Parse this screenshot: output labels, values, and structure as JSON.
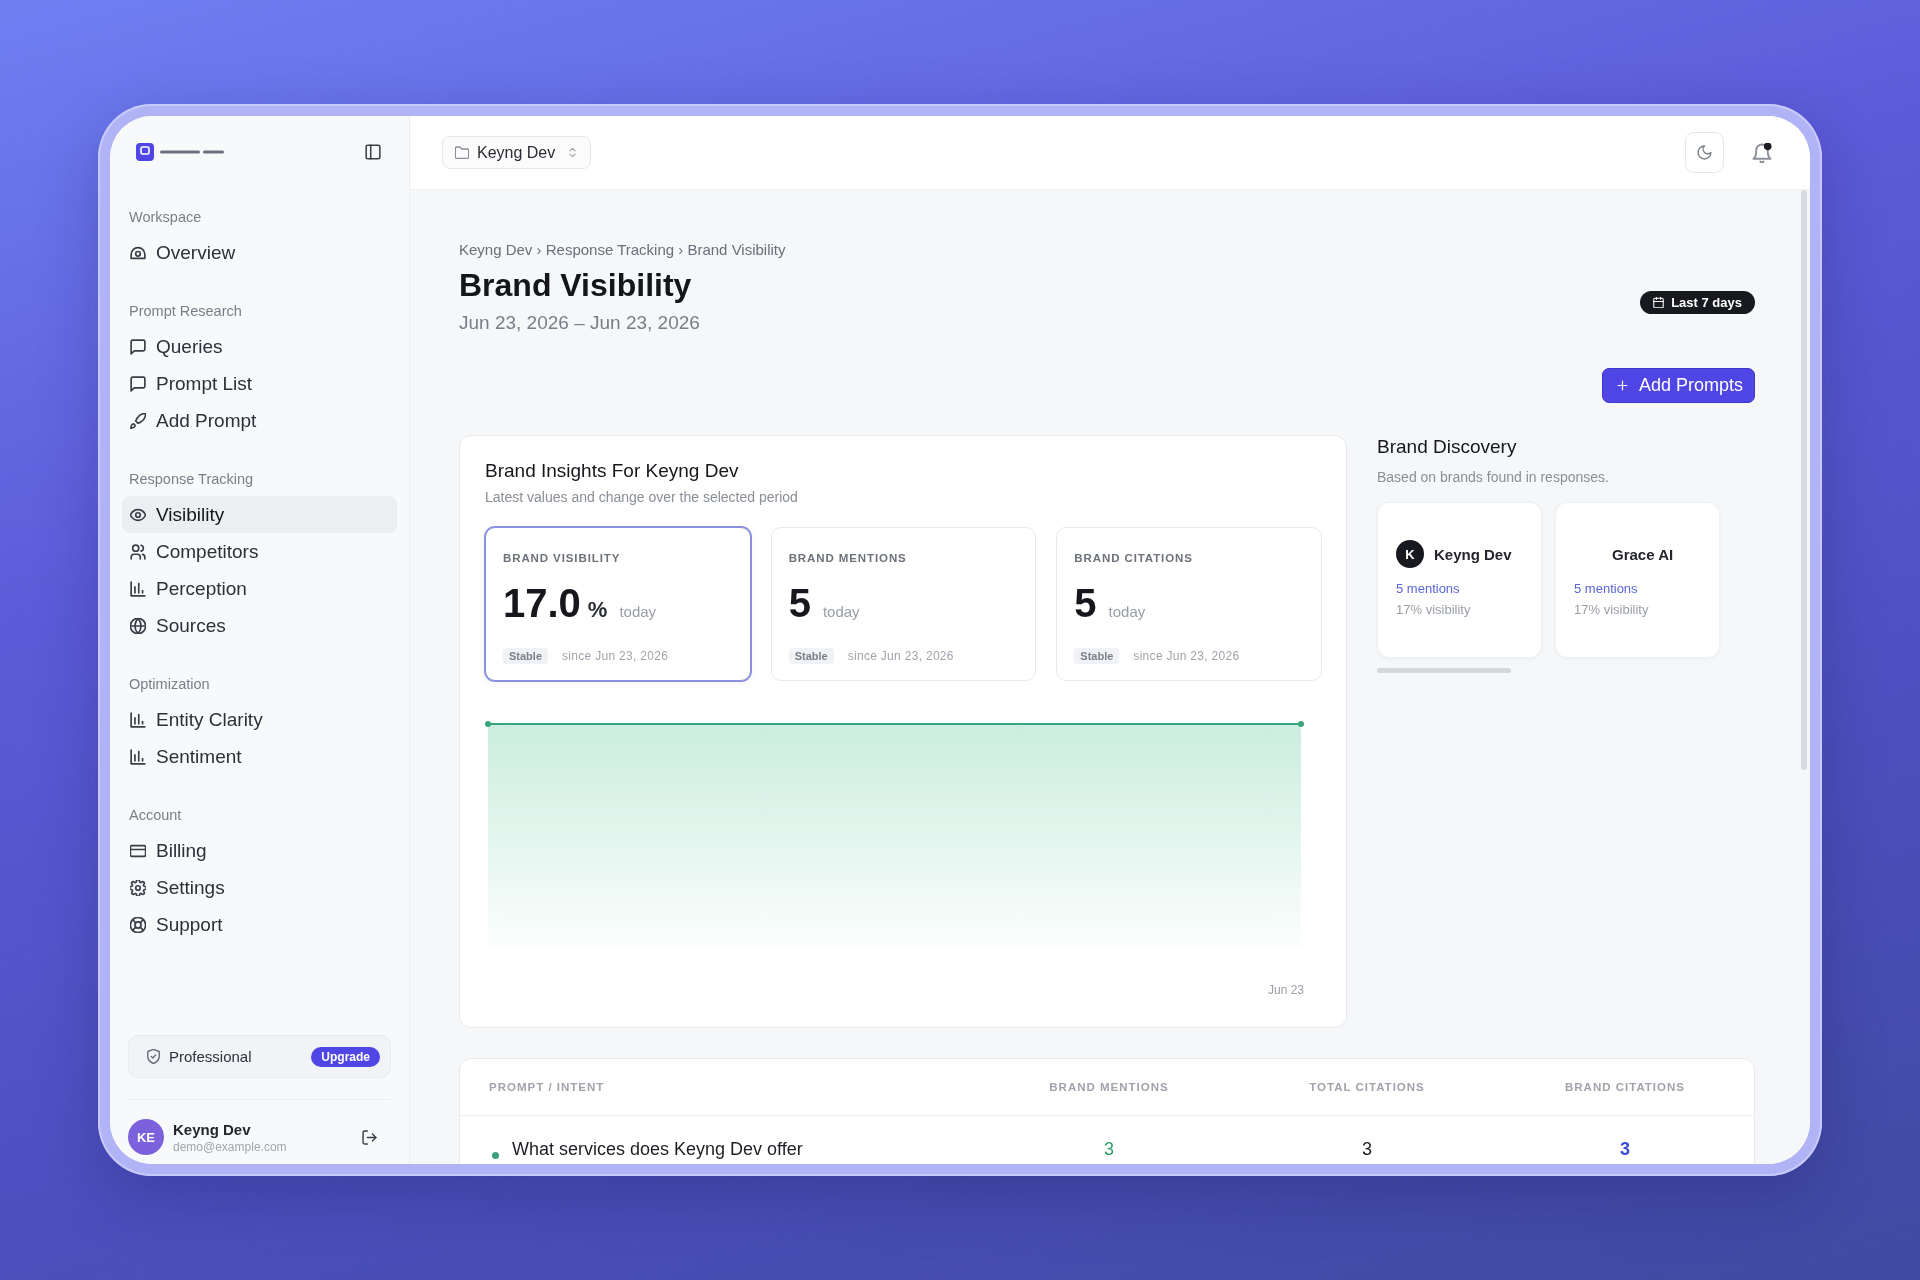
{
  "sidebar": {
    "sections": [
      {
        "title": "Workspace",
        "items": [
          {
            "label": "Overview",
            "selected": false
          }
        ]
      },
      {
        "title": "Prompt Research",
        "items": [
          {
            "label": "Queries",
            "selected": false
          },
          {
            "label": "Prompt List",
            "selected": false
          },
          {
            "label": "Add Prompt",
            "selected": false
          }
        ]
      },
      {
        "title": "Response Tracking",
        "items": [
          {
            "label": "Visibility",
            "selected": true
          },
          {
            "label": "Competitors",
            "selected": false
          },
          {
            "label": "Perception",
            "selected": false
          },
          {
            "label": "Sources",
            "selected": false
          }
        ]
      },
      {
        "title": "Optimization",
        "items": [
          {
            "label": "Entity Clarity",
            "selected": false
          },
          {
            "label": "Sentiment",
            "selected": false
          }
        ]
      },
      {
        "title": "Account",
        "items": [
          {
            "label": "Billing",
            "selected": false
          },
          {
            "label": "Settings",
            "selected": false
          },
          {
            "label": "Support",
            "selected": false
          }
        ]
      }
    ],
    "plan": {
      "name": "Professional",
      "action": "Upgrade"
    },
    "user": {
      "initials": "KE",
      "name": "Keyng Dev",
      "email": "demo@example.com"
    }
  },
  "topbar": {
    "workspace": "Keyng Dev"
  },
  "header": {
    "breadcrumb": "Keyng Dev › Response Tracking › Brand Visibility",
    "title": "Brand Visibility",
    "date_range": "Jun 23, 2026 – Jun 23, 2026",
    "period": "Last 7 days",
    "add_button": "Add Prompts"
  },
  "insights": {
    "title": "Brand Insights For Keyng Dev",
    "subtitle": "Latest values and change over the selected period",
    "metrics": [
      {
        "label": "BRAND VISIBILITY",
        "value": "17.0",
        "unit": "%",
        "period": "today",
        "trend": "Stable",
        "since": "since Jun 23, 2026",
        "selected": true
      },
      {
        "label": "BRAND MENTIONS",
        "value": "5",
        "period": "today",
        "trend": "Stable",
        "since": "since Jun 23, 2026",
        "selected": false
      },
      {
        "label": "BRAND CITATIONS",
        "value": "5",
        "period": "today",
        "trend": "Stable",
        "since": "since Jun 23, 2026",
        "selected": false
      }
    ],
    "chart": {
      "x_label": "Jun 23"
    }
  },
  "discovery": {
    "title": "Brand Discovery",
    "subtitle": "Based on brands found in responses.",
    "brands": [
      {
        "name": "Keyng Dev",
        "initial": "K",
        "mentions": "5 mentions",
        "visibility": "17% visibility"
      },
      {
        "name": "Grace AI",
        "mentions": "5 mentions",
        "visibility": "17% visibility"
      }
    ]
  },
  "table": {
    "columns": [
      "PROMPT / INTENT",
      "BRAND MENTIONS",
      "TOTAL CITATIONS",
      "BRAND CITATIONS"
    ],
    "rows": [
      {
        "color": "#3a9f78",
        "cells": [
          "What services does Keyng Dev offer",
          "3",
          "3",
          "3"
        ]
      }
    ]
  }
}
